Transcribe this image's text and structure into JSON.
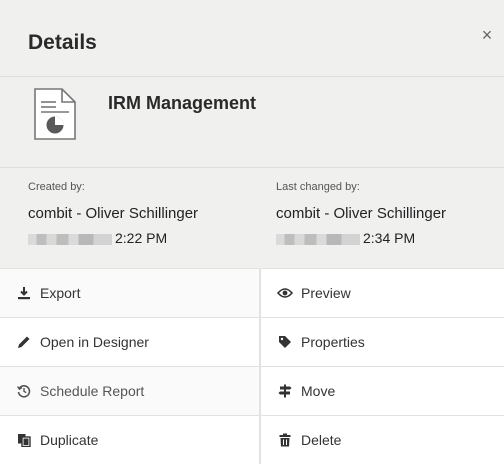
{
  "header": {
    "title": "Details",
    "close_glyph": "×"
  },
  "report": {
    "name": "IRM Management",
    "icon": "report-document-icon"
  },
  "meta": {
    "created_label": "Created by:",
    "created_user": "combit - Oliver Schillinger",
    "created_time": "2:22 PM",
    "changed_label": "Last changed by:",
    "changed_user": "combit - Oliver Schillinger",
    "changed_time": "2:34 PM"
  },
  "actions": {
    "export": "Export",
    "preview": "Preview",
    "open_designer": "Open in Designer",
    "properties": "Properties",
    "schedule": "Schedule Report",
    "move": "Move",
    "duplicate": "Duplicate",
    "delete": "Delete"
  }
}
